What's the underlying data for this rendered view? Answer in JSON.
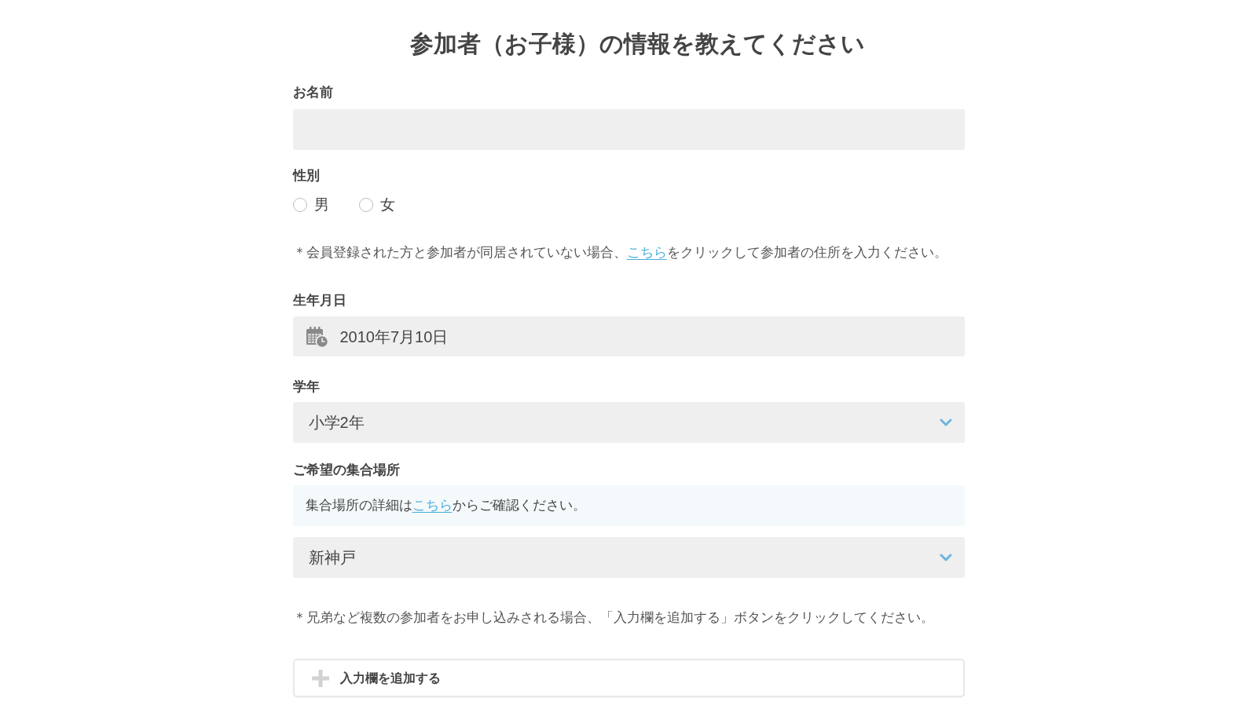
{
  "title": "参加者（お子様）の情報を教えてください",
  "fields": [
    {
      "kind": "text",
      "label": "お名前"
    },
    {
      "kind": "radio",
      "label": "性別",
      "options": [
        {
          "label": "男",
          "selected": false
        },
        {
          "label": "女",
          "selected": false
        }
      ]
    },
    {
      "kind": "note",
      "before": "＊会員登録された方と参加者が同居されていない場合、",
      "link": "こちら",
      "after": "をクリックして参加者の住所を入力ください。"
    },
    {
      "kind": "date",
      "label": "生年月日",
      "value": "2010年7月10日"
    },
    {
      "kind": "select",
      "label": "学年",
      "value": "小学2年"
    },
    {
      "kind": "select",
      "label": "ご希望の集合場所",
      "info": {
        "before": "集合場所の詳細は",
        "link": "こちら",
        "after": "からご確認ください。"
      },
      "value": "新神戸"
    },
    {
      "kind": "note",
      "before": "＊兄弟など複数の参加者をお申し込みされる場合、「入力欄を追加する」ボタンをクリックしてください。"
    }
  ],
  "add_button": {
    "label": "入力欄を追加する"
  }
}
